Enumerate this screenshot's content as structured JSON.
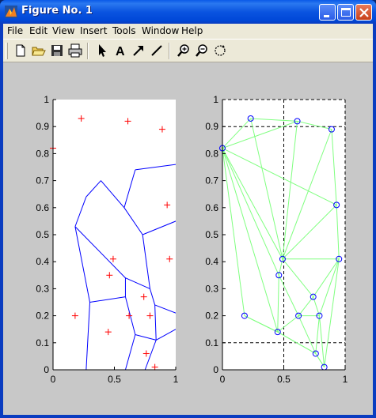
{
  "window": {
    "title": "Figure No. 1",
    "icon": "matlab-icon",
    "controls": [
      "minimize-icon",
      "maximize-icon",
      "close-icon"
    ]
  },
  "menu": {
    "file": "File",
    "edit": "Edit",
    "view": "View",
    "insert": "Insert",
    "tools": "Tools",
    "window": "Window",
    "help": "Help"
  },
  "toolbar": {
    "items": [
      "new-file-icon",
      "open-folder-icon",
      "save-icon",
      "print-icon",
      "select-arrow-icon",
      "insert-text-icon",
      "insert-arrow-icon",
      "insert-line-icon",
      "zoom-in-icon",
      "zoom-out-icon",
      "rotate-icon"
    ]
  },
  "colors": {
    "plot_bg": "#ffffff",
    "figure_bg": "#c8c8c8",
    "voronoi": "#0000ff",
    "points": "#ff0000",
    "delaunay": "#80ff80",
    "markers": "#0000ff"
  },
  "chart_data": [
    {
      "type": "scatter",
      "title": "",
      "xlabel": "",
      "ylabel": "",
      "xlim": [
        0,
        1
      ],
      "ylim": [
        0,
        1
      ],
      "xticks": [
        "0",
        "0.5",
        "1"
      ],
      "yticks": [
        "0",
        "0.1",
        "0.2",
        "0.3",
        "0.4",
        "0.5",
        "0.6",
        "0.7",
        "0.8",
        "0.9",
        "1"
      ],
      "grid": false,
      "series": [
        {
          "marker": "+",
          "color": "#ff0000",
          "x": [
            0.0,
            0.23,
            0.61,
            0.89,
            0.93,
            0.95,
            0.49,
            0.46,
            0.18,
            0.62,
            0.74,
            0.79,
            0.45,
            0.76,
            0.83
          ],
          "y": [
            0.82,
            0.93,
            0.92,
            0.89,
            0.61,
            0.41,
            0.41,
            0.35,
            0.2,
            0.2,
            0.27,
            0.2,
            0.14,
            0.06,
            0.01
          ]
        }
      ],
      "voronoi_edges": [
        [
          [
            0.18,
            0.53
          ],
          [
            0.27,
            0.64
          ]
        ],
        [
          [
            0.27,
            0.64
          ],
          [
            0.39,
            0.7
          ]
        ],
        [
          [
            0.39,
            0.7
          ],
          [
            0.58,
            0.6
          ]
        ],
        [
          [
            0.58,
            0.6
          ],
          [
            0.73,
            0.5
          ]
        ],
        [
          [
            0.73,
            0.5
          ],
          [
            1.0,
            0.55
          ]
        ],
        [
          [
            0.58,
            0.6
          ],
          [
            0.67,
            0.74
          ]
        ],
        [
          [
            0.67,
            0.74
          ],
          [
            1.0,
            0.76
          ]
        ],
        [
          [
            0.18,
            0.53
          ],
          [
            0.3,
            0.25
          ]
        ],
        [
          [
            0.18,
            0.53
          ],
          [
            0.59,
            0.34
          ]
        ],
        [
          [
            0.73,
            0.5
          ],
          [
            0.79,
            0.3
          ]
        ],
        [
          [
            0.59,
            0.34
          ],
          [
            0.79,
            0.3
          ]
        ],
        [
          [
            0.79,
            0.3
          ],
          [
            0.83,
            0.24
          ]
        ],
        [
          [
            0.59,
            0.34
          ],
          [
            0.59,
            0.27
          ]
        ],
        [
          [
            0.3,
            0.25
          ],
          [
            0.59,
            0.27
          ]
        ],
        [
          [
            0.3,
            0.25
          ],
          [
            0.27,
            0.0
          ]
        ],
        [
          [
            0.59,
            0.27
          ],
          [
            0.67,
            0.13
          ]
        ],
        [
          [
            0.67,
            0.13
          ],
          [
            0.84,
            0.11
          ]
        ],
        [
          [
            0.83,
            0.24
          ],
          [
            1.0,
            0.21
          ]
        ],
        [
          [
            0.83,
            0.24
          ],
          [
            0.84,
            0.11
          ]
        ],
        [
          [
            0.84,
            0.11
          ],
          [
            1.0,
            0.15
          ]
        ],
        [
          [
            0.67,
            0.13
          ],
          [
            0.59,
            0.0
          ]
        ],
        [
          [
            0.84,
            0.11
          ],
          [
            0.75,
            0.0
          ]
        ]
      ]
    },
    {
      "type": "scatter",
      "title": "",
      "xlabel": "",
      "ylabel": "",
      "xlim": [
        0,
        1
      ],
      "ylim": [
        0,
        1
      ],
      "xticks": [
        "0",
        "0.5",
        "1"
      ],
      "yticks": [
        "0",
        "0.1",
        "0.2",
        "0.3",
        "0.4",
        "0.5",
        "0.6",
        "0.7",
        "0.8",
        "0.9",
        "1"
      ],
      "grid": "dashed lines at x=0.5 and y=0.1, 0.9",
      "series": [
        {
          "marker": "o",
          "color": "#0000ff",
          "x": [
            0.0,
            0.23,
            0.61,
            0.89,
            0.93,
            0.95,
            0.49,
            0.46,
            0.18,
            0.62,
            0.74,
            0.79,
            0.45,
            0.76,
            0.83
          ],
          "y": [
            0.82,
            0.93,
            0.92,
            0.89,
            0.61,
            0.41,
            0.41,
            0.35,
            0.2,
            0.2,
            0.27,
            0.2,
            0.14,
            0.06,
            0.01
          ]
        }
      ],
      "delaunay_edges": [
        [
          0,
          1
        ],
        [
          1,
          2
        ],
        [
          2,
          3
        ],
        [
          3,
          4
        ],
        [
          4,
          5
        ],
        [
          5,
          14
        ],
        [
          14,
          13
        ],
        [
          13,
          12
        ],
        [
          12,
          8
        ],
        [
          8,
          0
        ],
        [
          0,
          6
        ],
        [
          0,
          7
        ],
        [
          0,
          12
        ],
        [
          0,
          4
        ],
        [
          1,
          6
        ],
        [
          2,
          6
        ],
        [
          3,
          6
        ],
        [
          4,
          6
        ],
        [
          6,
          5
        ],
        [
          6,
          10
        ],
        [
          6,
          7
        ],
        [
          7,
          9
        ],
        [
          7,
          12
        ],
        [
          8,
          12
        ],
        [
          9,
          12
        ],
        [
          9,
          10
        ],
        [
          9,
          11
        ],
        [
          10,
          5
        ],
        [
          10,
          11
        ],
        [
          11,
          5
        ],
        [
          11,
          14
        ],
        [
          11,
          13
        ],
        [
          9,
          13
        ],
        [
          12,
          13
        ],
        [
          13,
          14
        ],
        [
          0,
          2
        ]
      ]
    }
  ]
}
